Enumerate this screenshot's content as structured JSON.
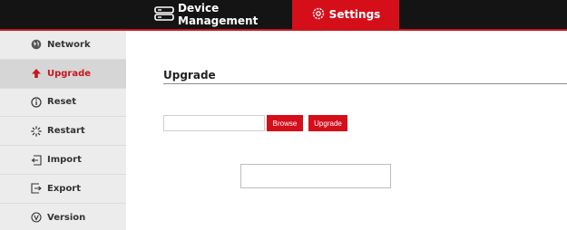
{
  "header": {
    "tabs": [
      {
        "label": "Device Management",
        "icon": "server-icon",
        "active": false
      },
      {
        "label": "Settings",
        "icon": "gear-icon",
        "active": true
      }
    ],
    "accent_color": "#d40f1a",
    "background_color": "#141414"
  },
  "sidebar": {
    "items": [
      {
        "label": "Network",
        "icon": "globe-icon",
        "active": false
      },
      {
        "label": "Upgrade",
        "icon": "arrow-up-icon",
        "active": true
      },
      {
        "label": "Reset",
        "icon": "info-icon",
        "active": false
      },
      {
        "label": "Restart",
        "icon": "spinner-icon",
        "active": false
      },
      {
        "label": "Import",
        "icon": "import-icon",
        "active": false
      },
      {
        "label": "Export",
        "icon": "export-icon",
        "active": false
      },
      {
        "label": "Version",
        "icon": "version-icon",
        "active": false
      }
    ]
  },
  "main": {
    "title": "Upgrade",
    "file_input": {
      "value": "",
      "placeholder": ""
    },
    "browse_label": "Browse",
    "upgrade_label": "Upgrade",
    "status_text": ""
  }
}
